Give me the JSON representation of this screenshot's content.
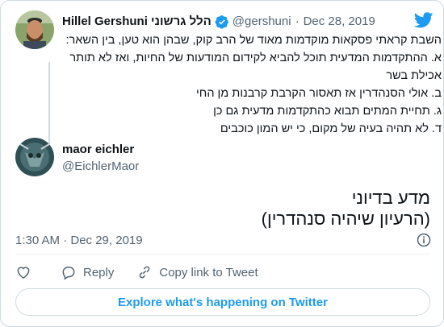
{
  "parent_tweet": {
    "display_name": "Hillel Gershuni הלל גרשוני",
    "handle": "@gershuni",
    "separator": "·",
    "date": "Dec 28, 2019",
    "text_lines": [
      "השבת קראתי פסקאות מוקדמות מאוד של הרב קוק, שבהן הוא טען, בין השאר:",
      "א. ההתקדמות המדעית תוכל להביא לקידום המודעות של החיות, ואז לא תותר",
      "אכילת בשר",
      "ב. אולי הסנהדרין אז תאסור הקרבת קרבנות מן החי",
      "ג. תחיית המתים תבוא כהתקדמות מדעית גם כן",
      "ד. לא תהיה בעיה של מקום, כי יש המון כוכבים"
    ]
  },
  "reply_tweet": {
    "display_name": "maor eichler",
    "handle": "@EichlerMaor",
    "text_lines": [
      "מדע בדיוני",
      "(הרעיון שיהיה סנהדרין)"
    ],
    "timestamp": "1:30 AM · Dec 29, 2019"
  },
  "actions": {
    "like_label": "",
    "reply_label": "Reply",
    "copy_link_label": "Copy link to Tweet"
  },
  "explore_button": {
    "label": "Explore what's happening on Twitter"
  },
  "icons": {
    "verified": "verified-badge-icon",
    "brand": "twitter-bird-icon",
    "info": "info-icon",
    "like": "heart-icon",
    "reply": "reply-bubble-icon",
    "copy_link": "link-icon"
  },
  "colors": {
    "brand_blue": "#1d9bf0",
    "text_primary": "#0f1419",
    "text_secondary": "#536471",
    "border": "#cfd9de"
  }
}
